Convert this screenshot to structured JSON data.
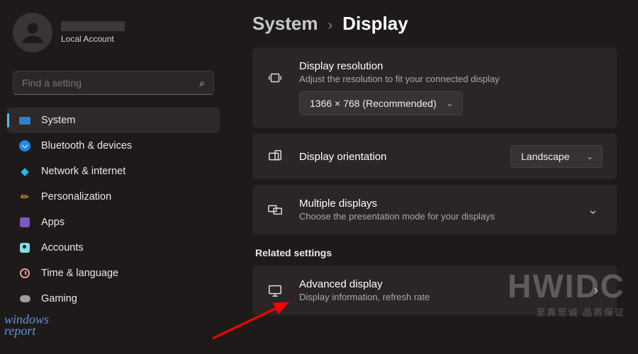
{
  "user": {
    "sub": "Local Account"
  },
  "search": {
    "placeholder": "Find a setting"
  },
  "nav": {
    "system": "System",
    "bluetooth": "Bluetooth & devices",
    "network": "Network & internet",
    "personalization": "Personalization",
    "apps": "Apps",
    "accounts": "Accounts",
    "time": "Time & language",
    "gaming": "Gaming"
  },
  "breadcrumb": {
    "parent": "System",
    "current": "Display"
  },
  "panels": {
    "resolution": {
      "title": "Display resolution",
      "sub": "Adjust the resolution to fit your connected display",
      "value": "1366 × 768 (Recommended)"
    },
    "orientation": {
      "title": "Display orientation",
      "value": "Landscape"
    },
    "multiple": {
      "title": "Multiple displays",
      "sub": "Choose the presentation mode for your displays"
    },
    "related_label": "Related settings",
    "advanced": {
      "title": "Advanced display",
      "sub": "Display information, refresh rate"
    }
  },
  "watermark": {
    "big": "HWIDC",
    "small": "至真至诚 品质保证",
    "logo1": "windows",
    "logo2": "report"
  }
}
